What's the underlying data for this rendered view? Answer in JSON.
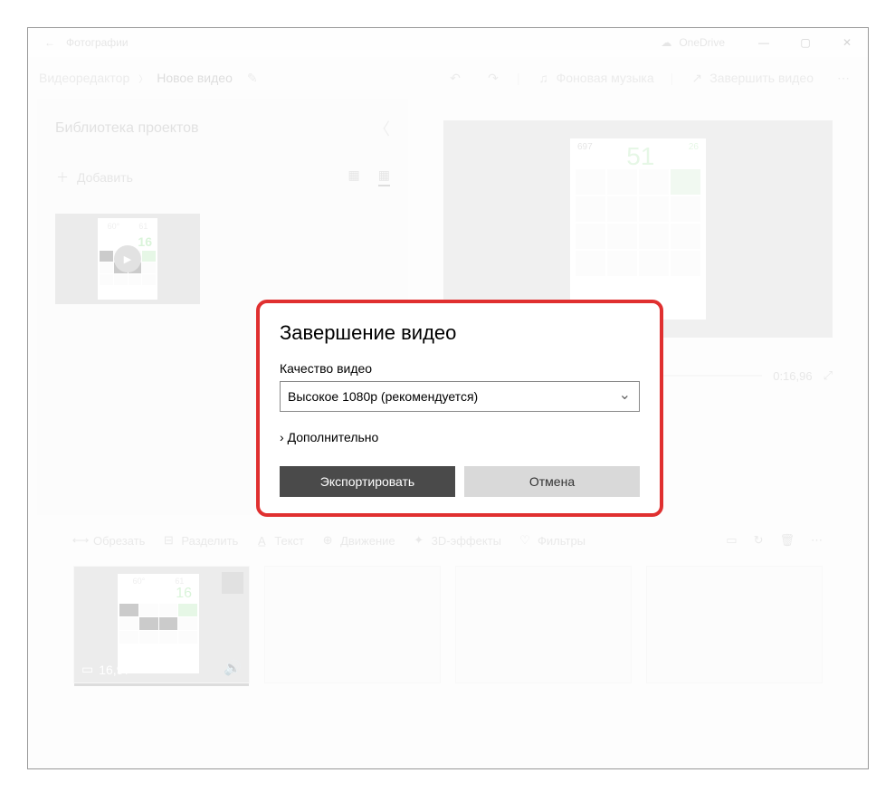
{
  "titlebar": {
    "title": "Фотографии",
    "onedrive": "OneDrive"
  },
  "crumbs": {
    "editor": "Видеоредактор",
    "project": "Новое видео",
    "bgmusic": "Фоновая музыка",
    "finish": "Завершить видео"
  },
  "library": {
    "title": "Библиотека проектов",
    "add": "Добавить",
    "thumb_num": "16"
  },
  "preview": {
    "big_num": "51",
    "small1": "697",
    "small2": "26",
    "time": "0:16,96"
  },
  "storyboard": {
    "trim": "Обрезать",
    "split": "Разделить",
    "text": "Текст",
    "motion": "Движение",
    "effects3d": "3D-эффекты",
    "filters": "Фильтры",
    "duration": "16,97"
  },
  "modal": {
    "title": "Завершение видео",
    "quality_label": "Качество видео",
    "quality_value": "Высокое 1080p (рекомендуется)",
    "advanced": "Дополнительно",
    "export": "Экспортировать",
    "cancel": "Отмена"
  }
}
